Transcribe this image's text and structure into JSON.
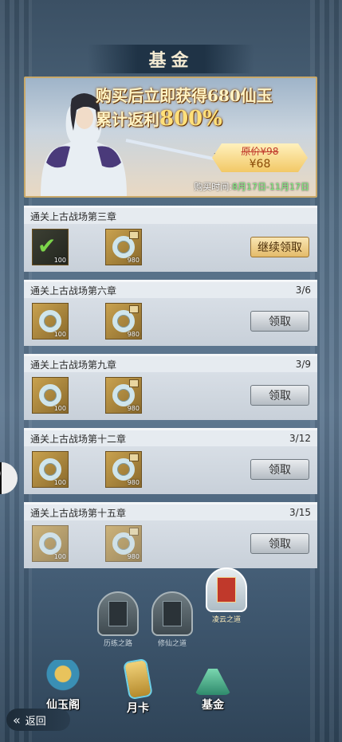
{
  "page": {
    "title": "基金"
  },
  "banner": {
    "promo_line1": "购买后立即获得680仙玉",
    "promo_line2_prefix": "累计返利",
    "promo_line2_value": "800%",
    "original_price": "原价¥98",
    "price": "¥68",
    "buy_time_label": "购买时间:",
    "buy_time_dates": "8月17日-11月17日"
  },
  "fund_list": [
    {
      "title": "通关上古战场第三章",
      "progress": "",
      "items": [
        {
          "qty": "100",
          "claimed": true
        },
        {
          "qty": "980",
          "claimed": false
        }
      ],
      "button": "继续领取",
      "button_style": "gold"
    },
    {
      "title": "通关上古战场第六章",
      "progress": "3/6",
      "items": [
        {
          "qty": "100",
          "claimed": false
        },
        {
          "qty": "980",
          "claimed": false
        }
      ],
      "button": "领取",
      "button_style": "gray"
    },
    {
      "title": "通关上古战场第九章",
      "progress": "3/9",
      "items": [
        {
          "qty": "100",
          "claimed": false
        },
        {
          "qty": "980",
          "claimed": false
        }
      ],
      "button": "领取",
      "button_style": "gray"
    },
    {
      "title": "通关上古战场第十二章",
      "progress": "3/12",
      "items": [
        {
          "qty": "100",
          "claimed": false
        },
        {
          "qty": "980",
          "claimed": false
        }
      ],
      "button": "领取",
      "button_style": "gray"
    },
    {
      "title": "通关上古战场第十五章",
      "progress": "3/15",
      "items": [
        {
          "qty": "100",
          "claimed": false
        },
        {
          "qty": "980",
          "claimed": false
        }
      ],
      "button": "领取",
      "button_style": "gray"
    }
  ],
  "fund_tabs": [
    {
      "label": "历练之路",
      "active": false
    },
    {
      "label": "修仙之道",
      "active": false
    },
    {
      "label": "凌云之道",
      "active": true
    }
  ],
  "bottom_nav": [
    {
      "label": "仙玉阁",
      "icon": "jade-pavilion-icon"
    },
    {
      "label": "月卡",
      "icon": "monthly-card-icon"
    },
    {
      "label": "基金",
      "icon": "fund-mountain-icon"
    }
  ],
  "back_label": "返回",
  "colors": {
    "gold": "#e4bb6a",
    "card": "#dde3ea",
    "accent_green": "#7ef07e"
  }
}
